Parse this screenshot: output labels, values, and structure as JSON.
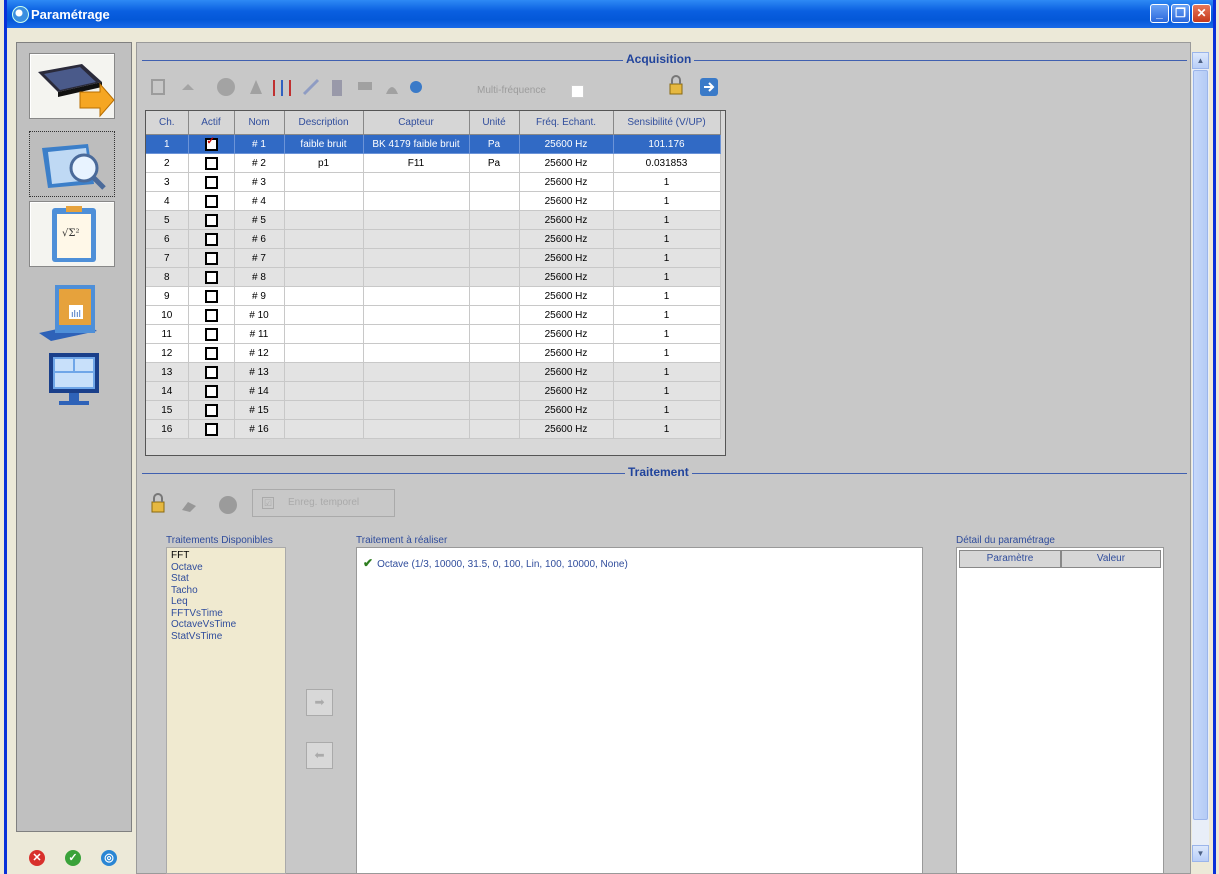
{
  "window": {
    "title": "Paramétrage"
  },
  "acquisition": {
    "title": "Acquisition",
    "multi_label": "Multi-fréquence",
    "columns": [
      "Ch.",
      "Actif",
      "Nom",
      "Description",
      "Capteur",
      "Unité",
      "Fréq. Echant.",
      "Sensibilité (V/UP)"
    ],
    "rows": [
      {
        "ch": "1",
        "actif": true,
        "nom": "# 1",
        "desc": "faible bruit",
        "capteur": "BK 4179 faible bruit",
        "unite": "Pa",
        "freq": "25600 Hz",
        "sens": "101.176"
      },
      {
        "ch": "2",
        "actif": false,
        "nom": "# 2",
        "desc": "p1",
        "capteur": "F11",
        "unite": "Pa",
        "freq": "25600 Hz",
        "sens": "0.031853"
      },
      {
        "ch": "3",
        "actif": false,
        "nom": "# 3",
        "desc": "",
        "capteur": "",
        "unite": "",
        "freq": "25600 Hz",
        "sens": "1"
      },
      {
        "ch": "4",
        "actif": false,
        "nom": "# 4",
        "desc": "",
        "capteur": "",
        "unite": "",
        "freq": "25600 Hz",
        "sens": "1"
      },
      {
        "ch": "5",
        "actif": false,
        "nom": "# 5",
        "desc": "",
        "capteur": "",
        "unite": "",
        "freq": "25600 Hz",
        "sens": "1"
      },
      {
        "ch": "6",
        "actif": false,
        "nom": "# 6",
        "desc": "",
        "capteur": "",
        "unite": "",
        "freq": "25600 Hz",
        "sens": "1"
      },
      {
        "ch": "7",
        "actif": false,
        "nom": "# 7",
        "desc": "",
        "capteur": "",
        "unite": "",
        "freq": "25600 Hz",
        "sens": "1"
      },
      {
        "ch": "8",
        "actif": false,
        "nom": "# 8",
        "desc": "",
        "capteur": "",
        "unite": "",
        "freq": "25600 Hz",
        "sens": "1"
      },
      {
        "ch": "9",
        "actif": false,
        "nom": "# 9",
        "desc": "",
        "capteur": "",
        "unite": "",
        "freq": "25600 Hz",
        "sens": "1"
      },
      {
        "ch": "10",
        "actif": false,
        "nom": "# 10",
        "desc": "",
        "capteur": "",
        "unite": "",
        "freq": "25600 Hz",
        "sens": "1"
      },
      {
        "ch": "11",
        "actif": false,
        "nom": "# 11",
        "desc": "",
        "capteur": "",
        "unite": "",
        "freq": "25600 Hz",
        "sens": "1"
      },
      {
        "ch": "12",
        "actif": false,
        "nom": "# 12",
        "desc": "",
        "capteur": "",
        "unite": "",
        "freq": "25600 Hz",
        "sens": "1"
      },
      {
        "ch": "13",
        "actif": false,
        "nom": "# 13",
        "desc": "",
        "capteur": "",
        "unite": "",
        "freq": "25600 Hz",
        "sens": "1"
      },
      {
        "ch": "14",
        "actif": false,
        "nom": "# 14",
        "desc": "",
        "capteur": "",
        "unite": "",
        "freq": "25600 Hz",
        "sens": "1"
      },
      {
        "ch": "15",
        "actif": false,
        "nom": "# 15",
        "desc": "",
        "capteur": "",
        "unite": "",
        "freq": "25600 Hz",
        "sens": "1"
      },
      {
        "ch": "16",
        "actif": false,
        "nom": "# 16",
        "desc": "",
        "capteur": "",
        "unite": "",
        "freq": "25600 Hz",
        "sens": "1"
      }
    ]
  },
  "traitement": {
    "title": "Traitement",
    "enreg_label": "Enreg. temporel",
    "dispo_label": "Traitements Disponibles",
    "dispo_items": [
      "FFT",
      "Octave",
      "Stat",
      "Tacho",
      "Leq",
      "FFTVsTime",
      "OctaveVsTime",
      "StatVsTime"
    ],
    "realiser_label": "Traitement à réaliser",
    "realiser_items": [
      "Octave (1/3, 10000, 31.5, 0, 100, Lin, 100, 10000, None)"
    ],
    "detail_label": "Détail du paramétrage",
    "detail_cols": [
      "Paramètre",
      "Valeur"
    ]
  },
  "colors": {
    "titlebar": "#0A5FE0",
    "accent": "#21449C",
    "selection": "#316AC5"
  }
}
